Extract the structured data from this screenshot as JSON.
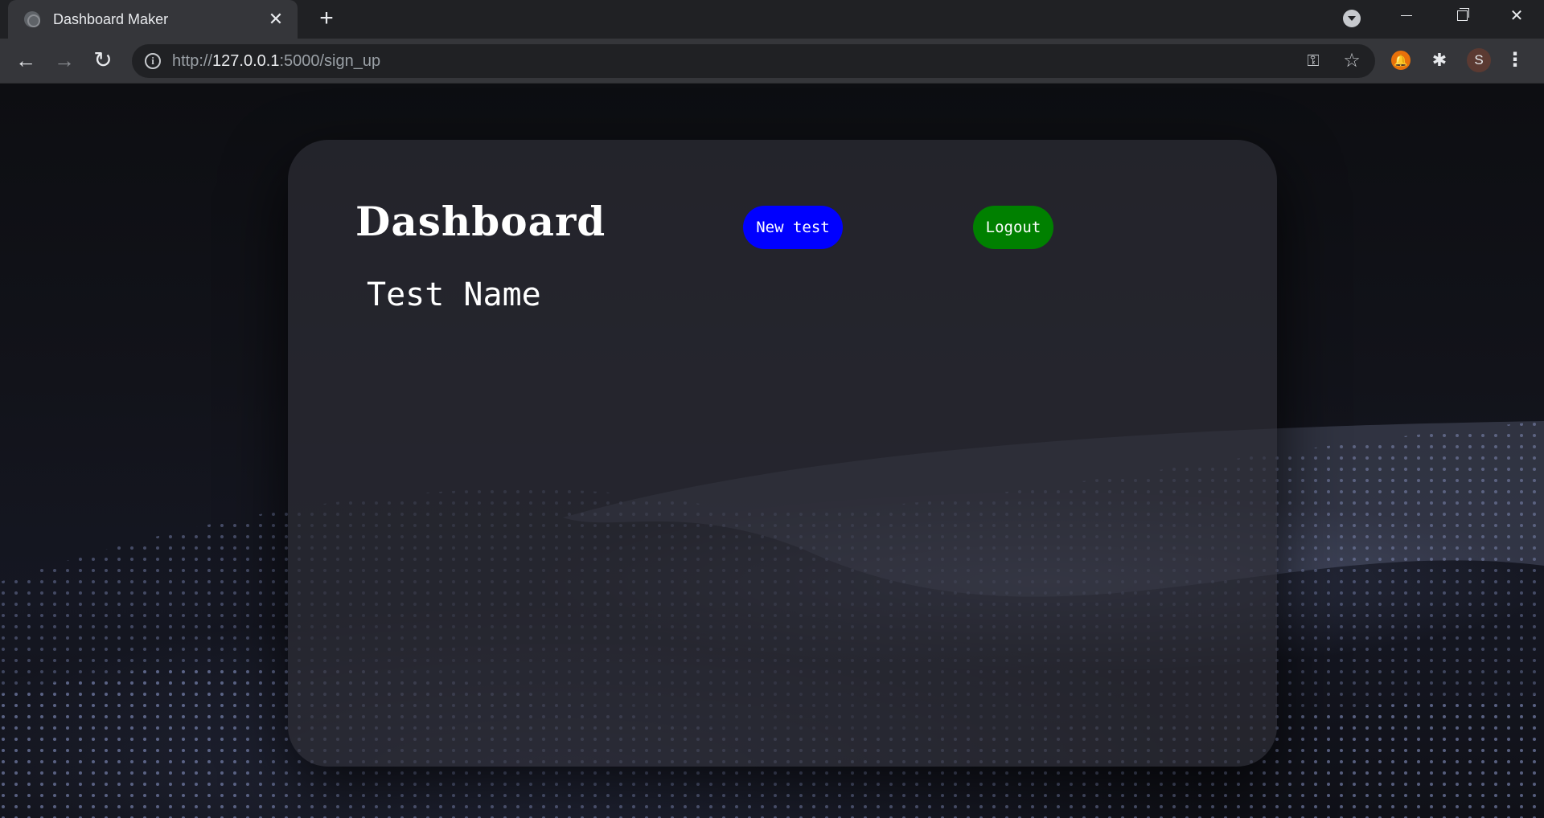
{
  "browser": {
    "tab_title": "Dashboard Maker",
    "tab_close": "✕",
    "new_tab": "+",
    "url_scheme": "http://",
    "url_host": "127.0.0.1",
    "url_path": ":5000/sign_up",
    "profile_initial": "S"
  },
  "page": {
    "title": "Dashboard",
    "new_test_label": "New test",
    "logout_label": "Logout",
    "test_name": "Test Name"
  },
  "colors": {
    "new_test_button": "#0000ff",
    "logout_button": "#008000"
  }
}
